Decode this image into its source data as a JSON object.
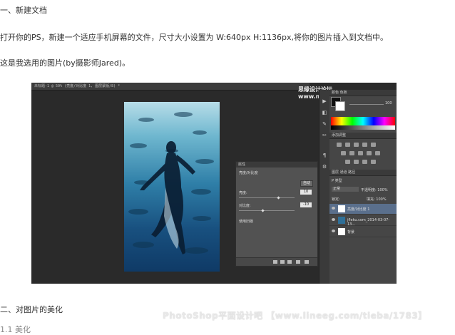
{
  "doc": {
    "heading1": "一、新建文档",
    "para1": "打开你的PS，新建一个适应手机屏幕的文件，尺寸大小设置为 W:640px H:1136px,将你的图片插入到文档中。",
    "para2": "这是我选用的图片(by摄影师Jared)。",
    "heading2": "二、对图片的美化",
    "para3": "1.1 美化",
    "footer_watermark": "PhotoShop平面设计吧 【www.lineeg.com/tieba/1783】"
  },
  "screenshot": {
    "tab_title": "未标题-1 @ 50% (亮度/对比度 1, 图层蒙版/8) *",
    "watermark": "思缘设计论坛 www.missyuan.com",
    "panels": {
      "color_tab": "颜色  色板",
      "color_value": "100",
      "adjust_tab": "添加调整",
      "layers_tab": "图层  通道  路径",
      "kind_label": "P 类型",
      "blend_mode": "正常",
      "opacity": "不透明度: 100%",
      "lock": "锁定:",
      "fill": "填充: 100%",
      "layers": [
        {
          "name": "亮度/对比度 1",
          "selected": true
        },
        {
          "name": "jfleku.com_2014-03-07-13...",
          "selected": false
        },
        {
          "name": "背景",
          "selected": false
        }
      ]
    },
    "properties": {
      "title": "属性",
      "subtitle": "亮度/对比度",
      "auto_button": "自动",
      "brightness_label": "亮度:",
      "brightness_value": "10",
      "contrast_label": "对比度:",
      "contrast_value": "-10",
      "legacy_label": "使用旧版"
    }
  }
}
